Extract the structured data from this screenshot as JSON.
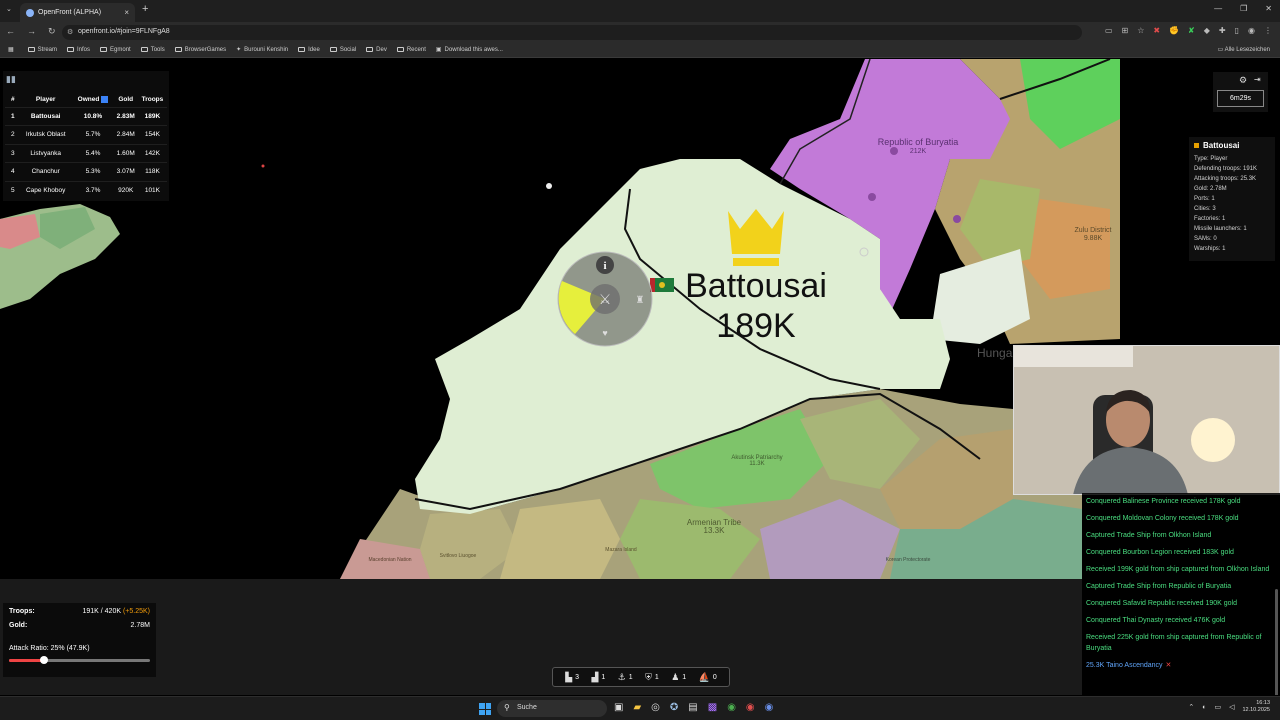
{
  "browser": {
    "tab_title": "OpenFront (ALPHA)",
    "url": "openfront.io/#join=9FLNFgA8",
    "bookmarks": [
      "Stream",
      "Infos",
      "Egmont",
      "Tools",
      "BrowserGames",
      "Burouni Kenshin",
      "Idee",
      "Social",
      "Dev",
      "Recent",
      "Download this awes..."
    ],
    "all_bookmarks": "Alle Lesezeichen"
  },
  "leaderboard": {
    "headers": [
      "#",
      "Player",
      "Owned",
      "Gold",
      "Troops"
    ],
    "rows": [
      {
        "rank": "1",
        "player": "Battousai",
        "owned": "10.8%",
        "gold": "2.83M",
        "troops": "189K"
      },
      {
        "rank": "2",
        "player": "Irkutsk Oblast",
        "owned": "5.7%",
        "gold": "2.84M",
        "troops": "154K"
      },
      {
        "rank": "3",
        "player": "Listvyanka",
        "owned": "5.4%",
        "gold": "1.60M",
        "troops": "142K"
      },
      {
        "rank": "4",
        "player": "Chanchur",
        "owned": "5.3%",
        "gold": "3.07M",
        "troops": "118K"
      },
      {
        "rank": "5",
        "player": "Cape Khoboy",
        "owned": "3.7%",
        "gold": "920K",
        "troops": "101K"
      }
    ]
  },
  "timer": "6m29s",
  "player_label": {
    "name": "Battousai",
    "troops": "189K"
  },
  "map_labels": {
    "buryatia": "Republic of Buryatia",
    "buryatia_troops": "212K",
    "zulu": "Zulu District",
    "zulu_troops": "9.88K",
    "hunga": "Hunga",
    "akutinsk": "Akutinsk Patriarchy",
    "akutinsk_troops": "11.3K",
    "armenian": "Armenian Tribe",
    "armenian_troops": "13.3K",
    "mazara": "Mazara Island",
    "sabadi": "Svitlovo Liuogoe",
    "macedon": "Macedonian Nation",
    "kurean": "Korean Protectorate"
  },
  "player_info": {
    "name": "Battousai",
    "rows": [
      "Type: Player",
      "Defending troops: 191K",
      "Attacking troops: 25.3K",
      "Gold: 2.78M",
      "Ports: 1",
      "Cities: 3",
      "Factories: 1",
      "Missile launchers: 1",
      "SAMs: 0",
      "Warships: 1"
    ]
  },
  "event_log": [
    {
      "text": "Conquered Balinese Province received 178K gold",
      "color": "green"
    },
    {
      "text": "Conquered Moldovan Colony received 178K gold",
      "color": "green"
    },
    {
      "text": "Captured Trade Ship from Olkhon Island",
      "color": "green"
    },
    {
      "text": "Conquered Bourbon Legion received 183K gold",
      "color": "green"
    },
    {
      "text": "Received 199K gold from ship captured from Olkhon Island",
      "color": "green"
    },
    {
      "text": "Captured Trade Ship from Republic of Buryatia",
      "color": "green"
    },
    {
      "text": "Conquered Safavid Republic received 190K gold",
      "color": "green"
    },
    {
      "text": "Conquered Thai Dynasty received 476K gold",
      "color": "green"
    },
    {
      "text": "Received 225K gold from ship captured from Republic of Buryatia",
      "color": "green"
    },
    {
      "text": "25.3K Taino Ascendancy",
      "color": "blue"
    }
  ],
  "stats": {
    "troops_label": "Troops:",
    "troops_value": "191K / 420K",
    "troops_rate": "(+5.25K)",
    "gold_label": "Gold:",
    "gold_value": "2.78M",
    "attack_ratio": "Attack Ratio: 25% (47.9K)",
    "attack_ratio_fraction": 0.25
  },
  "build_bar": [
    {
      "icon": "city-icon",
      "count": "3"
    },
    {
      "icon": "factory-icon",
      "count": "1"
    },
    {
      "icon": "anchor-icon",
      "count": "1"
    },
    {
      "icon": "shield-icon",
      "count": "1"
    },
    {
      "icon": "missile-silo-icon",
      "count": "1"
    },
    {
      "icon": "warship-icon",
      "count": "0"
    }
  ],
  "taskbar": {
    "search": "Suche",
    "time": "16:13",
    "date": "12.10.2025"
  },
  "colors": {
    "player_territory": "#dfeed3",
    "buryatia": "#c27ad8",
    "accent_green": "#4ade80",
    "accent_red": "#ef4444"
  }
}
